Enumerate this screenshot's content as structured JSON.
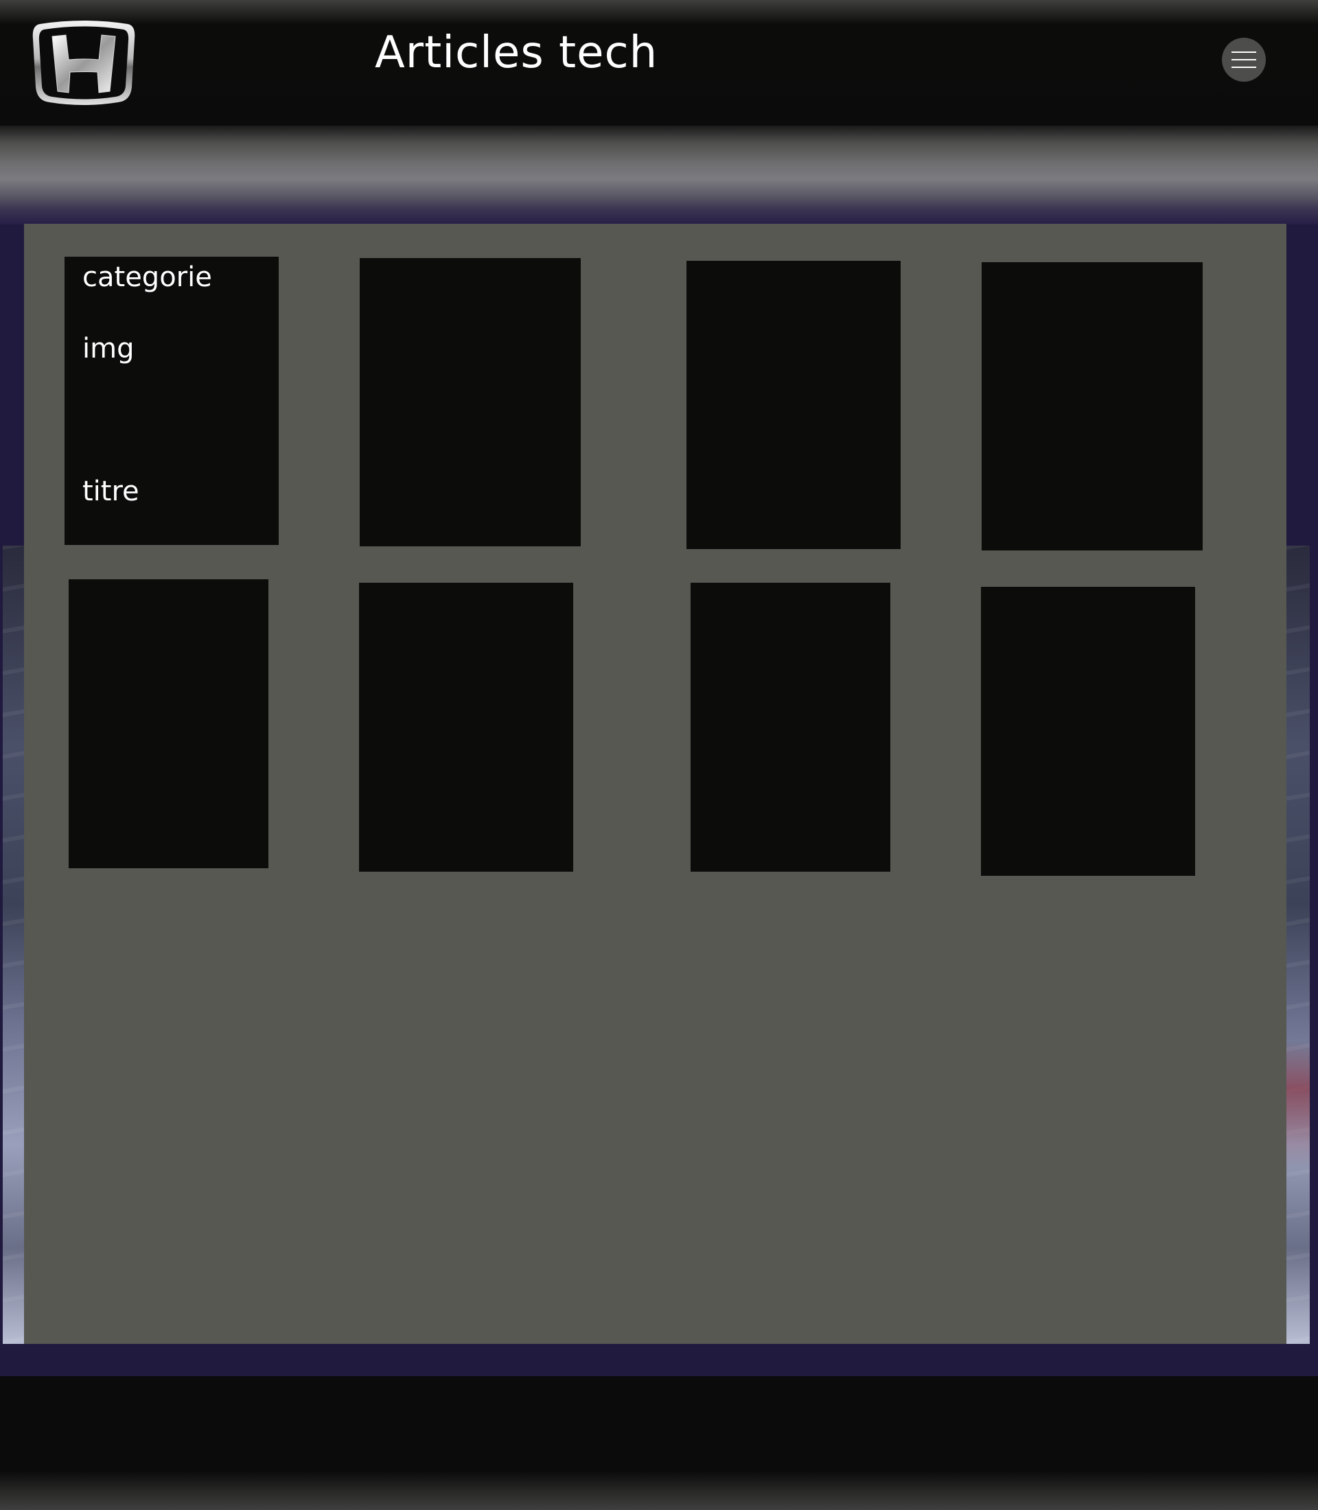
{
  "header": {
    "title": "Articles tech",
    "logo_icon": "honda-logo-icon",
    "menu_icon": "hamburger-menu-icon"
  },
  "articles": [
    {
      "category": "categorie",
      "image": "img",
      "title": "titre"
    },
    {
      "category": "",
      "image": "",
      "title": ""
    },
    {
      "category": "",
      "image": "",
      "title": ""
    },
    {
      "category": "",
      "image": "",
      "title": ""
    },
    {
      "category": "",
      "image": "",
      "title": ""
    },
    {
      "category": "",
      "image": "",
      "title": ""
    },
    {
      "category": "",
      "image": "",
      "title": ""
    },
    {
      "category": "",
      "image": "",
      "title": ""
    }
  ],
  "colors": {
    "header_bg": "#0b0b0b",
    "panel_bg": "#575852",
    "card_bg": "#0c0c0b",
    "background_accent": "#211a3f",
    "menu_button_bg": "#4d4d4b",
    "text": "#ffffff"
  }
}
